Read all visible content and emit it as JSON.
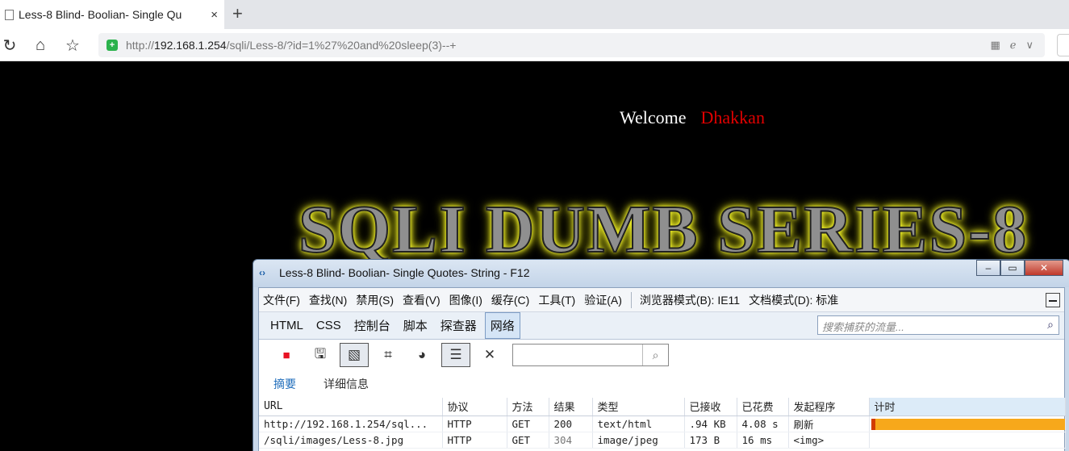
{
  "browser": {
    "tab_title": "Less-8 Blind- Boolian- Single Qu",
    "tab_close": "×",
    "new_tab": "+",
    "url_prefix": "http://",
    "url_host": "192.168.1.254",
    "url_path": "/sqli/Less-8/?id=1%27%20and%20sleep(3)--+"
  },
  "page": {
    "welcome": "Welcome",
    "user_name": "Dhakkan",
    "banner": "SQLI DUMB SERIES-8"
  },
  "devtools": {
    "window_title": "Less-8 Blind- Boolian- Single Quotes- String - F12",
    "menu": [
      "文件(F)",
      "查找(N)",
      "禁用(S)",
      "查看(V)",
      "图像(I)",
      "缓存(C)",
      "工具(T)",
      "验证(A)"
    ],
    "browser_mode": "浏览器模式(B): IE11",
    "doc_mode": "文档模式(D): 标准",
    "tabs": [
      "HTML",
      "CSS",
      "控制台",
      "脚本",
      "探查器",
      "网络"
    ],
    "active_tab": "网络",
    "capture_search_placeholder": "搜索捕获的流量...",
    "subtabs": [
      "摘要",
      "详细信息"
    ],
    "columns": [
      "URL",
      "协议",
      "方法",
      "结果",
      "类型",
      "已接收",
      "已花费",
      "发起程序",
      "计时"
    ],
    "rows": [
      {
        "url": "http://192.168.1.254/sql...",
        "protocol": "HTTP",
        "method": "GET",
        "result": "200",
        "type": "text/html",
        "received": ".94 KB",
        "taken": "4.08 s",
        "initiator": "刷新"
      },
      {
        "url": "/sqli/images/Less-8.jpg",
        "protocol": "HTTP",
        "method": "GET",
        "result": "304",
        "type": "image/jpeg",
        "received": "173 B",
        "taken": "16 ms",
        "initiator": "<img>"
      }
    ],
    "colors": {
      "timing_bar": "#f7a81b",
      "timing_bar_start": "#d23c00",
      "stop_button": "#e81123"
    }
  }
}
